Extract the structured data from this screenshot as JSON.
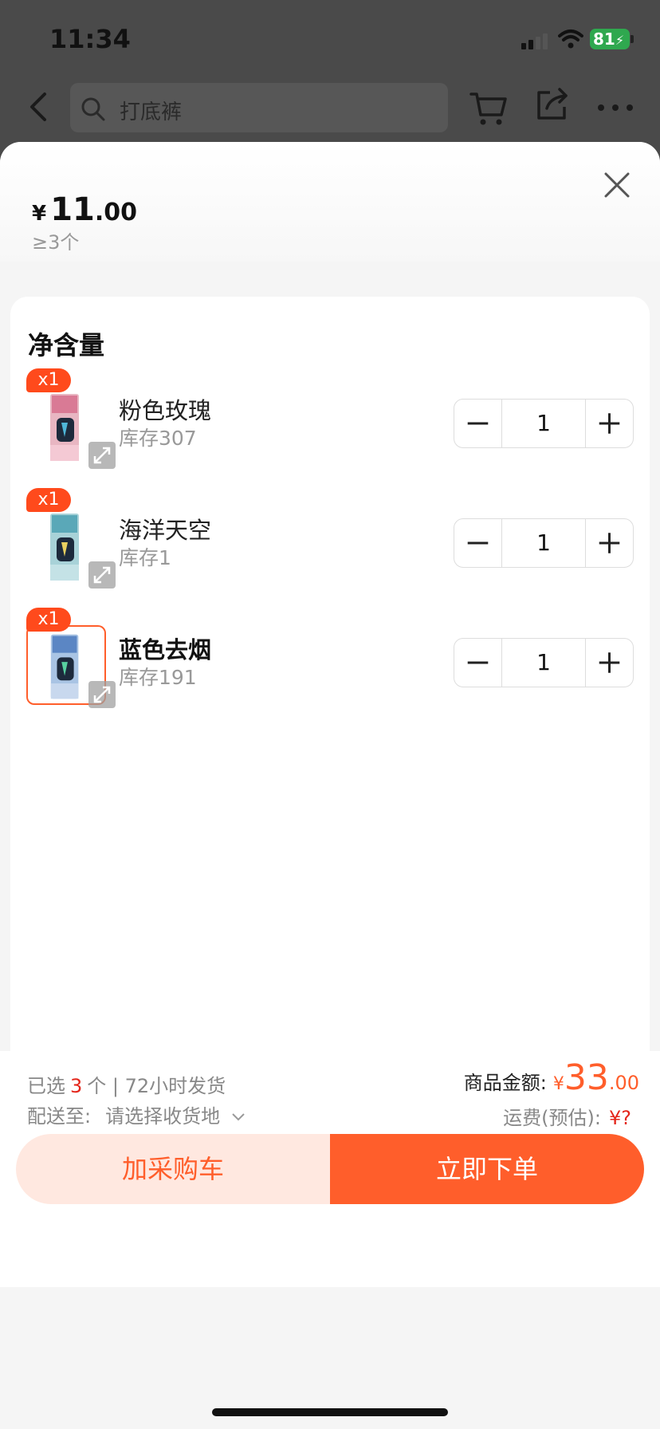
{
  "status_bar": {
    "time": "11:34",
    "battery": "81"
  },
  "nav": {
    "search_placeholder": "打底裤"
  },
  "sheet": {
    "price_currency": "¥",
    "price_integer": "11",
    "price_decimal": ".00",
    "min_order": "≥3个",
    "spec_title": "净含量",
    "items": [
      {
        "badge": "x1",
        "name": "粉色玫瑰",
        "stock": "库存307",
        "qty": "1"
      },
      {
        "badge": "x1",
        "name": "海洋天空",
        "stock": "库存1",
        "qty": "1"
      },
      {
        "badge": "x1",
        "name": "蓝色去烟",
        "stock": "库存191",
        "qty": "1"
      }
    ]
  },
  "footer": {
    "selected_prefix": "已选",
    "selected_count": "3",
    "selected_suffix": "个 | 72小时发货",
    "ship_label": "配送至:",
    "ship_address": "请选择收货地",
    "amount_label": "商品金额:",
    "amount_currency": "¥",
    "amount_integer": "33",
    "amount_decimal": ".00",
    "freight_label": "运费(预估):",
    "freight_value": "¥?",
    "add_cart": "加采购车",
    "order_now": "立即下单"
  },
  "colors": {
    "accent": "#ff5e2b",
    "accent_light": "#ffe8e0",
    "badge": "#ff4a1c",
    "count_red": "#e4261b"
  }
}
